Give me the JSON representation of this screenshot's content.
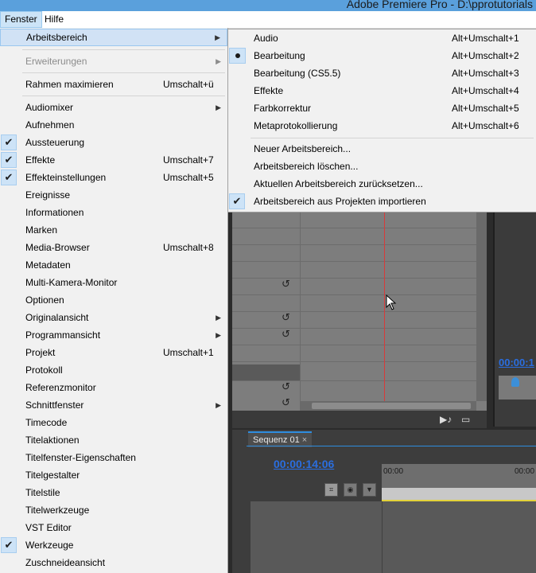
{
  "window": {
    "title": "Adobe Premiere Pro - D:\\pprotutorials"
  },
  "menubar": {
    "items": [
      {
        "label": "Fenster"
      },
      {
        "label": "Hilfe"
      }
    ]
  },
  "menu": {
    "items": [
      {
        "label": "Arbeitsbereich",
        "shortcut": "",
        "submenu": true
      },
      {
        "label": "Erweiterungen",
        "shortcut": "",
        "submenu": true,
        "disabled": true
      },
      {
        "label": "Rahmen maximieren",
        "shortcut": "Umschalt+ü"
      },
      {
        "label": "Audiomixer",
        "shortcut": "",
        "submenu": true
      },
      {
        "label": "Aufnehmen",
        "shortcut": ""
      },
      {
        "label": "Aussteuerung",
        "shortcut": "",
        "checked": true
      },
      {
        "label": "Effekte",
        "shortcut": "Umschalt+7",
        "checked": true
      },
      {
        "label": "Effekteinstellungen",
        "shortcut": "Umschalt+5",
        "checked": true
      },
      {
        "label": "Ereignisse",
        "shortcut": ""
      },
      {
        "label": "Informationen",
        "shortcut": ""
      },
      {
        "label": "Marken",
        "shortcut": ""
      },
      {
        "label": "Media-Browser",
        "shortcut": "Umschalt+8"
      },
      {
        "label": "Metadaten",
        "shortcut": ""
      },
      {
        "label": "Multi-Kamera-Monitor",
        "shortcut": ""
      },
      {
        "label": "Optionen",
        "shortcut": ""
      },
      {
        "label": "Originalansicht",
        "shortcut": "",
        "submenu": true
      },
      {
        "label": "Programmansicht",
        "shortcut": "",
        "submenu": true
      },
      {
        "label": "Projekt",
        "shortcut": "Umschalt+1"
      },
      {
        "label": "Protokoll",
        "shortcut": ""
      },
      {
        "label": "Referenzmonitor",
        "shortcut": ""
      },
      {
        "label": "Schnittfenster",
        "shortcut": "",
        "submenu": true
      },
      {
        "label": "Timecode",
        "shortcut": ""
      },
      {
        "label": "Titelaktionen",
        "shortcut": ""
      },
      {
        "label": "Titelfenster-Eigenschaften",
        "shortcut": ""
      },
      {
        "label": "Titelgestalter",
        "shortcut": ""
      },
      {
        "label": "Titelstile",
        "shortcut": ""
      },
      {
        "label": "Titelwerkzeuge",
        "shortcut": ""
      },
      {
        "label": "VST Editor",
        "shortcut": ""
      },
      {
        "label": "Werkzeuge",
        "shortcut": "",
        "checked": true
      },
      {
        "label": "Zuschneideansicht",
        "shortcut": ""
      }
    ]
  },
  "submenu": {
    "items": [
      {
        "label": "Audio",
        "shortcut": "Alt+Umschalt+1"
      },
      {
        "label": "Bearbeitung",
        "shortcut": "Alt+Umschalt+2",
        "selected": true
      },
      {
        "label": "Bearbeitung (CS5.5)",
        "shortcut": "Alt+Umschalt+3"
      },
      {
        "label": "Effekte",
        "shortcut": "Alt+Umschalt+4"
      },
      {
        "label": "Farbkorrektur",
        "shortcut": "Alt+Umschalt+5"
      },
      {
        "label": "Metaprotokollierung",
        "shortcut": "Alt+Umschalt+6"
      },
      {
        "label": "Neuer Arbeitsbereich...",
        "shortcut": ""
      },
      {
        "label": "Arbeitsbereich löschen...",
        "shortcut": ""
      },
      {
        "label": "Aktuellen Arbeitsbereich zurücksetzen...",
        "shortcut": ""
      },
      {
        "label": "Arbeitsbereich aus Projekten importieren",
        "shortcut": "",
        "checked": true
      }
    ]
  },
  "app": {
    "sequence_tab": {
      "label": "Sequenz 01",
      "close": "×"
    },
    "sequence_timecode": "00:00:14:06",
    "program_timecode": "00:00:1",
    "ruler_labels": [
      "00:00",
      "00:00"
    ]
  },
  "colors": {
    "menu_bg": "#f1f1f1",
    "hover": "#d1e2f5",
    "timecode": "#2a6ee0",
    "playhead": "#d83a3a"
  }
}
